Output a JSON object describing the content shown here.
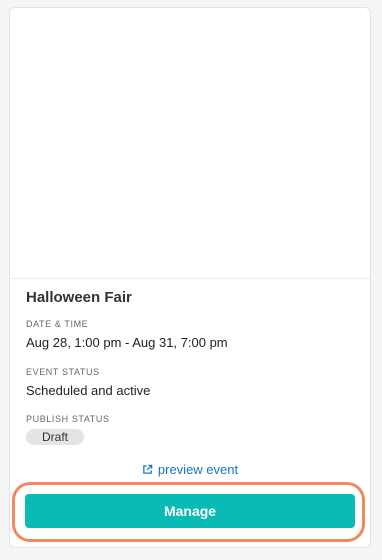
{
  "event": {
    "title": "Halloween Fair",
    "date_time_label": "DATE & TIME",
    "date_time_value": "Aug 28, 1:00 pm - Aug 31, 7:00 pm",
    "event_status_label": "EVENT STATUS",
    "event_status_value": "Scheduled and active",
    "publish_status_label": "PUBLISH STATUS",
    "publish_status_value": "Draft"
  },
  "actions": {
    "preview_label": "preview event",
    "preview_icon": "external-link-icon",
    "manage_label": "Manage"
  },
  "colors": {
    "accent": "#0abab5",
    "link": "#1a75c4",
    "highlight": "#f08a5d",
    "badge_bg": "#e4e4e4"
  }
}
